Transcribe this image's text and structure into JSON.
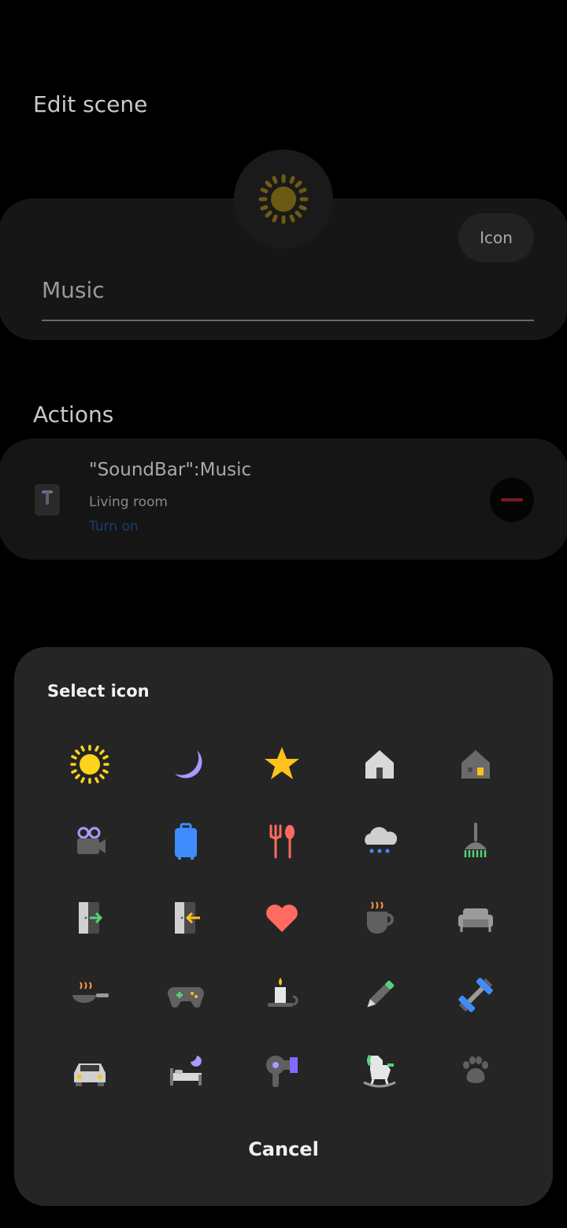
{
  "header": {
    "title": "Edit scene"
  },
  "scene": {
    "icon": "sun-icon",
    "icon_button_label": "Icon",
    "name_value": "Music"
  },
  "actions": {
    "title": "Actions",
    "items": [
      {
        "device": "\"SoundBar\":Music",
        "room": "Living room",
        "state": "Turn on",
        "icon": "soundbar-icon",
        "remove_icon": "minus-icon"
      }
    ]
  },
  "dialog": {
    "title": "Select icon",
    "icons": [
      "sun-icon",
      "moon-icon",
      "star-icon",
      "house-icon",
      "house-lit-icon",
      "video-camera-icon",
      "suitcase-icon",
      "fork-spoon-icon",
      "rain-cloud-icon",
      "broom-icon",
      "door-enter-icon",
      "door-exit-icon",
      "heart-icon",
      "coffee-cup-icon",
      "sofa-icon",
      "frying-pan-icon",
      "gamepad-icon",
      "candle-icon",
      "pencil-icon",
      "dumbbell-icon",
      "car-icon",
      "bed-icon",
      "hair-dryer-icon",
      "rocking-horse-icon",
      "paw-icon"
    ],
    "cancel_label": "Cancel"
  },
  "colors": {
    "sun": "#ffd21c",
    "moon": "#a99bff",
    "star": "#ffc21a",
    "heart": "#ff6b5f",
    "blue": "#3f8cff",
    "accent_blue": "#173d70",
    "remove_red": "#7a1a20"
  }
}
